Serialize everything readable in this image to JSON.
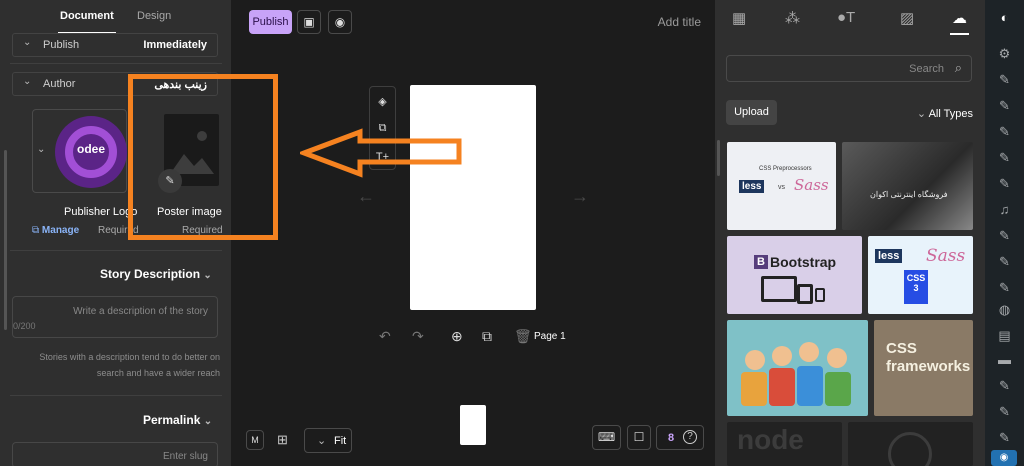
{
  "left_panel": {
    "tabs": [
      "Document",
      "Design"
    ],
    "publish": {
      "label": "Publish",
      "value": "Immediately"
    },
    "author": {
      "label": "Author",
      "value": "زینب بندهی"
    },
    "publisher_logo": {
      "label": "Publisher Logo",
      "logo_text": "odee",
      "manage": "Manage",
      "required": "Required"
    },
    "poster": {
      "label": "Poster image",
      "required": "Required"
    },
    "description": {
      "title": "Story Description",
      "placeholder": "Write a description of the story",
      "counter": "0/200",
      "hint": "Stories with a description tend to do better on search and have a wider reach"
    },
    "permalink": {
      "title": "Permalink",
      "placeholder": "Enter slug"
    }
  },
  "toolbar": {
    "publish": "Publish",
    "add_title": "Add title"
  },
  "canvas": {
    "page_label": "Page 1",
    "fit_label": "Fit",
    "help_count": "8"
  },
  "right_panel": {
    "search_placeholder": "Search",
    "upload_label": "Upload",
    "types_label": "All Types",
    "tiles": {
      "t1_title": "CSS Preprocessors",
      "t1_less": "less",
      "t1_vs": "vs",
      "t1_sass": "Sass",
      "t2_text": "فروشگاه اینترنتی اکوان",
      "t3_text": "Bootstrap",
      "t4_less": "less",
      "t4_sass": "Sass",
      "t4_css": "CSS",
      "t5_text": "CSS frameworks",
      "t6_text": "node"
    }
  },
  "colors": {
    "publish_bg": "#c8a3f8",
    "annotation": "#f58220",
    "logo_purple": "#5b2487"
  }
}
